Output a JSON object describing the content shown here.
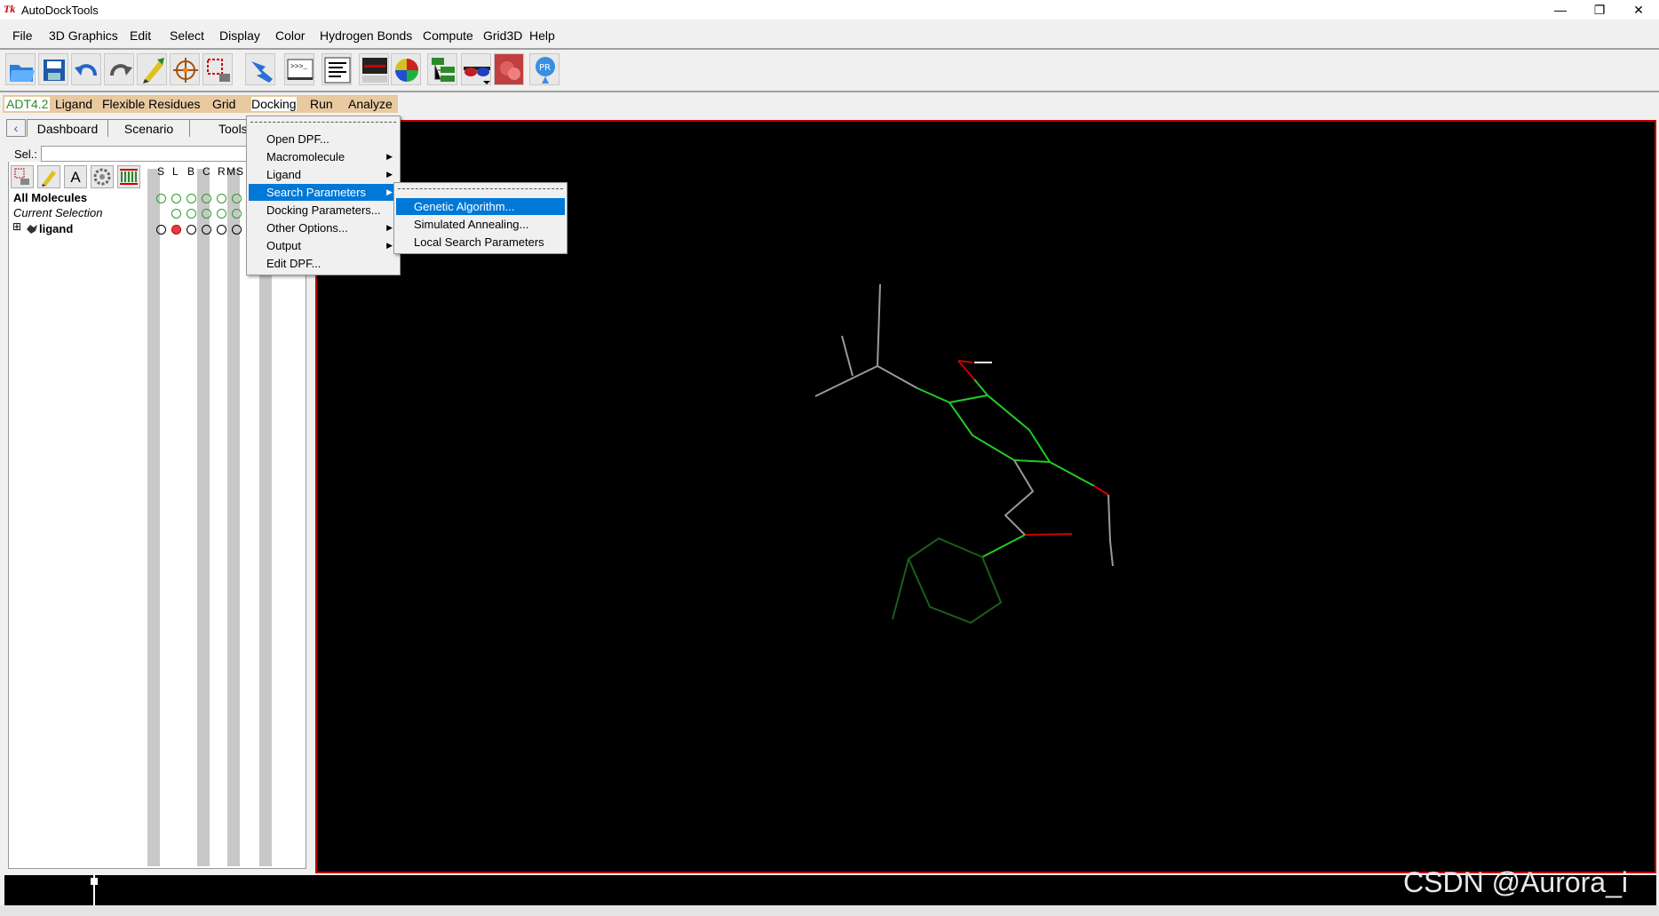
{
  "window": {
    "app_icon": "Tk",
    "title": "AutoDockTools",
    "controls": [
      "—",
      "❐",
      "✕"
    ]
  },
  "menubar": [
    "File",
    "3D Graphics",
    "Edit",
    "Select",
    "Display",
    "Color",
    "Hydrogen Bonds",
    "Compute",
    "Grid3D",
    "Help"
  ],
  "toolbar": {
    "icons": [
      "open-folder-icon",
      "save-icon",
      "undo-icon",
      "redo-icon",
      "pencil-icon",
      "target-icon",
      "select-icon",
      "hand-pointer-icon",
      "python-shell-icon",
      "text-lines-icon",
      "monitor-icon",
      "color-sphere-icon",
      "tree-icon",
      "stereo-glasses-icon",
      "dna-icon",
      "info-icon"
    ]
  },
  "adt_menubar": {
    "version_label": "ADT4.2",
    "items": [
      "Ligand",
      "Flexible Residues",
      "Grid",
      "Docking",
      "Run",
      "Analyze"
    ]
  },
  "dashboard": {
    "tabs": [
      "Dashboard",
      "Scenario",
      "Tools"
    ],
    "sel_label": "Sel.:",
    "sel_value": "",
    "column_headers": [
      "S",
      "L",
      "B",
      "C",
      "R",
      "M",
      "S"
    ],
    "tree": {
      "all_molecules": "All Molecules",
      "current_selection": "Current Selection",
      "expand_symbol": "⊞",
      "molecule": "ligand"
    }
  },
  "docking_menu": {
    "items": [
      {
        "label": "Open DPF...",
        "submenu": false
      },
      {
        "label": "Macromolecule",
        "submenu": true
      },
      {
        "label": "Ligand",
        "submenu": true
      },
      {
        "label": "Search Parameters",
        "submenu": true,
        "selected": true
      },
      {
        "label": "Docking Parameters...",
        "submenu": false
      },
      {
        "label": "Other Options...",
        "submenu": true
      },
      {
        "label": "Output",
        "submenu": true
      },
      {
        "label": "Edit DPF...",
        "submenu": false
      }
    ]
  },
  "search_submenu": {
    "items": [
      {
        "label": "Genetic Algorithm...",
        "selected": true
      },
      {
        "label": "Simulated Annealing...",
        "selected": false
      },
      {
        "label": "Local Search Parameters",
        "selected": false
      }
    ]
  },
  "watermark": "CSDN @Aurora_i",
  "colors": {
    "accent": "#0078d7",
    "adt_bar": "#e8c9a0",
    "viewer_border": "#c00000",
    "bond_green": "#22cc22",
    "bond_gray": "#999999",
    "bond_red": "#cc0000"
  }
}
